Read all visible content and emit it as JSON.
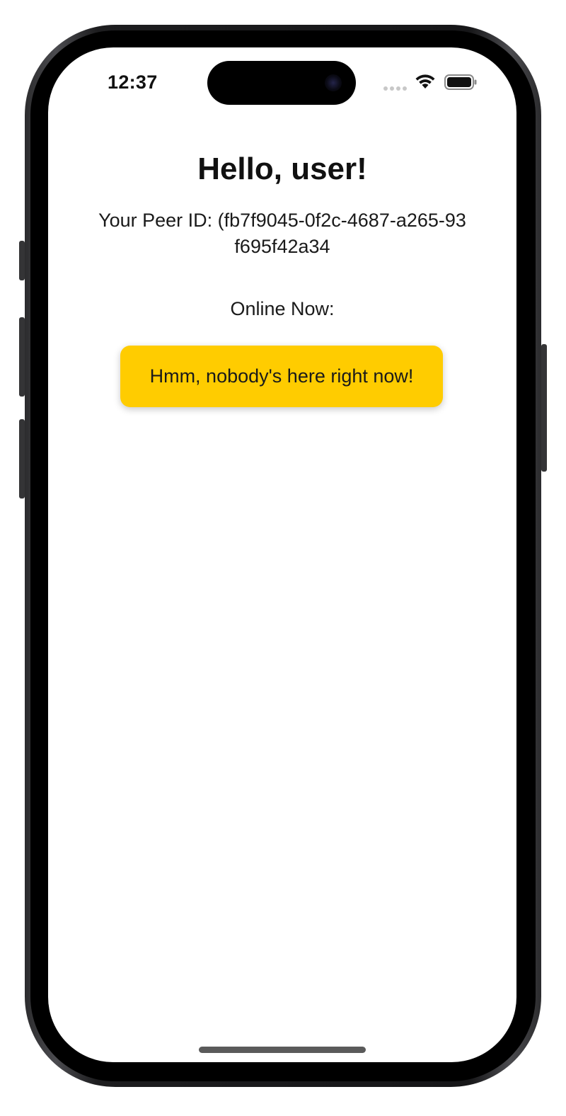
{
  "status_bar": {
    "time": "12:37",
    "icons": [
      "cellular-signal-icon",
      "wifi-icon",
      "battery-icon"
    ]
  },
  "main": {
    "title": "Hello, user!",
    "peer_id": "Your Peer ID: (fb7f9045-0f2c-4687-a265-93f695f42a34",
    "online_label": "Online Now:",
    "empty_message": "Hmm, nobody's here right now!"
  },
  "colors": {
    "accent": "#FFCC00",
    "text": "#111111",
    "background": "#FFFFFF",
    "device_frame": "#1D1D1F"
  }
}
